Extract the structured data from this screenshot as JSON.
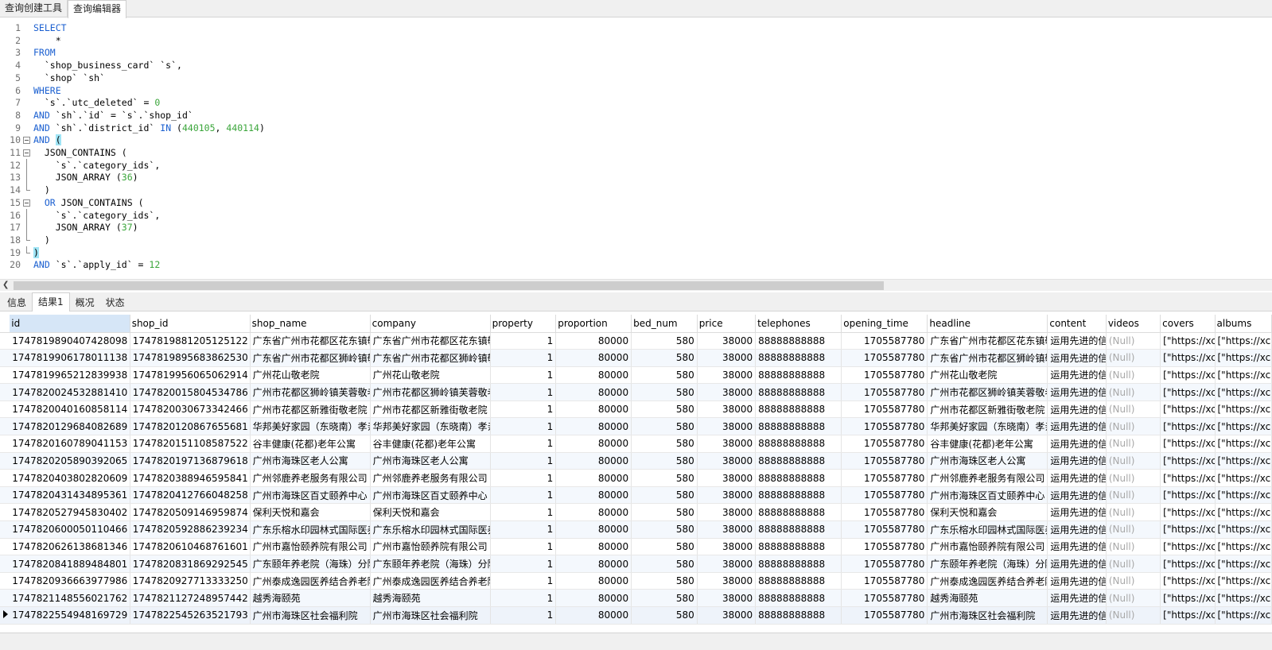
{
  "top_tabs": [
    "查询创建工具",
    "查询编辑器"
  ],
  "active_top_tab": 1,
  "editor": {
    "lines": [
      [
        [
          "kw",
          "SELECT"
        ]
      ],
      [
        [
          "txt",
          "    *"
        ]
      ],
      [
        [
          "kw",
          "FROM"
        ]
      ],
      [
        [
          "txt",
          "  `shop_business_card` `s`,"
        ]
      ],
      [
        [
          "txt",
          "  `shop` `sh`"
        ]
      ],
      [
        [
          "kw",
          "WHERE"
        ]
      ],
      [
        [
          "txt",
          "  `s`.`utc_deleted` = "
        ],
        [
          "num",
          "0"
        ]
      ],
      [
        [
          "kw",
          "AND"
        ],
        [
          "txt",
          " `sh`.`id` = `s`.`shop_id`"
        ]
      ],
      [
        [
          "kw",
          "AND"
        ],
        [
          "txt",
          " `sh`.`district_id` "
        ],
        [
          "kw",
          "IN"
        ],
        [
          "txt",
          " ("
        ],
        [
          "num",
          "440105"
        ],
        [
          "txt",
          ", "
        ],
        [
          "num",
          "440114"
        ],
        [
          "txt",
          ")"
        ]
      ],
      [
        [
          "kw",
          "AND"
        ],
        [
          "txt",
          " "
        ],
        [
          "hl",
          "("
        ]
      ],
      [
        [
          "txt",
          "  JSON_CONTAINS ("
        ]
      ],
      [
        [
          "txt",
          "    `s`.`category_ids`,"
        ]
      ],
      [
        [
          "txt",
          "    JSON_ARRAY ("
        ],
        [
          "num",
          "36"
        ],
        [
          "txt",
          ")"
        ]
      ],
      [
        [
          "txt",
          "  )"
        ]
      ],
      [
        [
          "txt",
          "  "
        ],
        [
          "kw",
          "OR"
        ],
        [
          "txt",
          " JSON_CONTAINS ("
        ]
      ],
      [
        [
          "txt",
          "    `s`.`category_ids`,"
        ]
      ],
      [
        [
          "txt",
          "    JSON_ARRAY ("
        ],
        [
          "num",
          "37"
        ],
        [
          "txt",
          ")"
        ]
      ],
      [
        [
          "txt",
          "  )"
        ]
      ],
      [
        [
          "hl",
          ")"
        ]
      ],
      [
        [
          "kw",
          "AND"
        ],
        [
          "txt",
          " `s`.`apply_id` = "
        ],
        [
          "num",
          "12"
        ]
      ]
    ]
  },
  "result_tabs": [
    "信息",
    "结果1",
    "概况",
    "状态"
  ],
  "active_result_tab": 1,
  "grid": {
    "columns": [
      "id",
      "shop_id",
      "shop_name",
      "company",
      "property",
      "proportion",
      "bed_num",
      "price",
      "telephones",
      "opening_time",
      "headline",
      "content",
      "videos",
      "covers",
      "albums"
    ],
    "rows": [
      [
        "1747819890407428098",
        "1747819881205125122",
        "广东省广州市花都区花东镇敬",
        "广东省广州市花都区花东镇敬",
        "1",
        "80000",
        "580",
        "38000",
        "88888888888",
        "1705587780",
        "广东省广州市花都区花东镇敬",
        "运用先进的信",
        "(Null)",
        "[\"https://xcp",
        "[\"https://xcp"
      ],
      [
        "1747819906178011138",
        "1747819895683862530",
        "广东省广州市花都区狮岭镇敬",
        "广东省广州市花都区狮岭镇敬",
        "1",
        "80000",
        "580",
        "38000",
        "88888888888",
        "1705587780",
        "广东省广州市花都区狮岭镇敬",
        "运用先进的信",
        "(Null)",
        "[\"https://xcp",
        "[\"https://xcp"
      ],
      [
        "1747819965212839938",
        "1747819956065062914",
        "广州花山敬老院",
        "广州花山敬老院",
        "1",
        "80000",
        "580",
        "38000",
        "88888888888",
        "1705587780",
        "广州花山敬老院",
        "运用先进的信",
        "(Null)",
        "[\"https://xcp",
        "[\"https://xcp"
      ],
      [
        "1747820024532881410",
        "1747820015804534786",
        "广州市花都区狮岭镇芙蓉敬老",
        "广州市花都区狮岭镇芙蓉敬老",
        "1",
        "80000",
        "580",
        "38000",
        "88888888888",
        "1705587780",
        "广州市花都区狮岭镇芙蓉敬老",
        "运用先进的信",
        "(Null)",
        "[\"https://xcp",
        "[\"https://xcp"
      ],
      [
        "1747820040160858114",
        "1747820030673342466",
        "广州市花都区新雅街敬老院",
        "广州市花都区新雅街敬老院",
        "1",
        "80000",
        "580",
        "38000",
        "88888888888",
        "1705587780",
        "广州市花都区新雅街敬老院",
        "运用先进的信",
        "(Null)",
        "[\"https://xcp",
        "[\"https://xcp"
      ],
      [
        "1747820129684082689",
        "1747820120867655681",
        "华邦美好家园（东晓南）孝亲",
        "华邦美好家园（东晓南）孝亲",
        "1",
        "80000",
        "580",
        "38000",
        "88888888888",
        "1705587780",
        "华邦美好家园（东晓南）孝亲",
        "运用先进的信",
        "(Null)",
        "[\"https://xcp",
        "[\"https://xcp"
      ],
      [
        "1747820160789041153",
        "1747820151108587522",
        "谷丰健康(花都)老年公寓",
        "谷丰健康(花都)老年公寓",
        "1",
        "80000",
        "580",
        "38000",
        "88888888888",
        "1705587780",
        "谷丰健康(花都)老年公寓",
        "运用先进的信",
        "(Null)",
        "[\"https://xcp",
        "[\"https://xcp"
      ],
      [
        "1747820205890392065",
        "1747820197136879618",
        "广州市海珠区老人公寓",
        "广州市海珠区老人公寓",
        "1",
        "80000",
        "580",
        "38000",
        "88888888888",
        "1705587780",
        "广州市海珠区老人公寓",
        "运用先进的信",
        "(Null)",
        "[\"https://xcp",
        "[\"https://xcp"
      ],
      [
        "1747820403802820609",
        "1747820388946595841",
        "广州邻鹿养老服务有限公司",
        "广州邻鹿养老服务有限公司",
        "1",
        "80000",
        "580",
        "38000",
        "88888888888",
        "1705587780",
        "广州邻鹿养老服务有限公司",
        "运用先进的信",
        "(Null)",
        "[\"https://xcp",
        "[\"https://xcp"
      ],
      [
        "1747820431434895361",
        "1747820412766048258",
        "广州市海珠区百丈颐养中心",
        "广州市海珠区百丈颐养中心",
        "1",
        "80000",
        "580",
        "38000",
        "88888888888",
        "1705587780",
        "广州市海珠区百丈颐养中心",
        "运用先进的信",
        "(Null)",
        "[\"https://xcp",
        "[\"https://xcp"
      ],
      [
        "1747820527945830402",
        "1747820509146959874",
        "保利天悦和嘉会",
        "保利天悦和嘉会",
        "1",
        "80000",
        "580",
        "38000",
        "88888888888",
        "1705587780",
        "保利天悦和嘉会",
        "运用先进的信",
        "(Null)",
        "[\"https://xcp",
        "[\"https://xcp"
      ],
      [
        "1747820600050110466",
        "1747820592886239234",
        "广东乐榕水印园林式国际医养",
        "广东乐榕水印园林式国际医养",
        "1",
        "80000",
        "580",
        "38000",
        "88888888888",
        "1705587780",
        "广东乐榕水印园林式国际医养",
        "运用先进的信",
        "(Null)",
        "[\"https://xcp",
        "[\"https://xcp"
      ],
      [
        "1747820626138681346",
        "1747820610468761601",
        "广州市嘉怡颐养院有限公司",
        "广州市嘉怡颐养院有限公司",
        "1",
        "80000",
        "580",
        "38000",
        "88888888888",
        "1705587780",
        "广州市嘉怡颐养院有限公司",
        "运用先进的信",
        "(Null)",
        "[\"https://xcp",
        "[\"https://xcp"
      ],
      [
        "1747820841889484801",
        "1747820831869292545",
        "广东颐年养老院（海珠）分院",
        "广东颐年养老院（海珠）分院",
        "1",
        "80000",
        "580",
        "38000",
        "88888888888",
        "1705587780",
        "广东颐年养老院（海珠）分院",
        "运用先进的信",
        "(Null)",
        "[\"https://xcp",
        "[\"https://xcp"
      ],
      [
        "1747820936663977986",
        "1747820927713333250",
        "广州泰成逸园医养结合养老院",
        "广州泰成逸园医养结合养老院",
        "1",
        "80000",
        "580",
        "38000",
        "88888888888",
        "1705587780",
        "广州泰成逸园医养结合养老院",
        "运用先进的信",
        "(Null)",
        "[\"https://xcp",
        "[\"https://xcp"
      ],
      [
        "1747821148556021762",
        "1747821127248957442",
        "越秀海颐苑",
        "越秀海颐苑",
        "1",
        "80000",
        "580",
        "38000",
        "88888888888",
        "1705587780",
        "越秀海颐苑",
        "运用先进的信",
        "(Null)",
        "[\"https://xcp",
        "[\"https://xcp"
      ],
      [
        "1747822554948169729",
        "1747822545263521793",
        "广州市海珠区社会福利院",
        "广州市海珠区社会福利院",
        "1",
        "80000",
        "580",
        "38000",
        "88888888888",
        "1705587780",
        "广州市海珠区社会福利院",
        "运用先进的信",
        "(Null)",
        "[\"https://xcp",
        "[\"https://xcp"
      ]
    ],
    "current_row": 16
  }
}
